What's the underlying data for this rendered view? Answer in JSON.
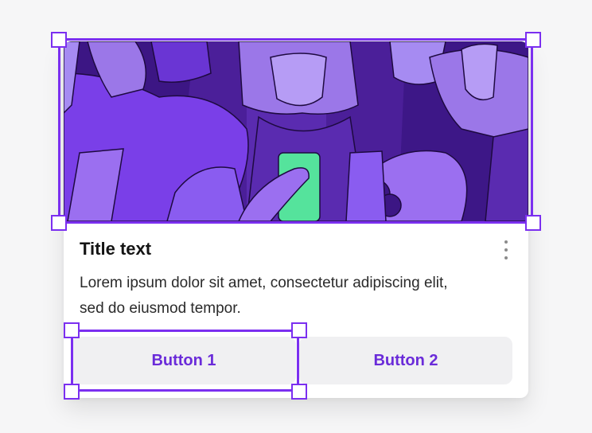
{
  "card": {
    "title": "Title text",
    "description": "Lorem ipsum dolor sit amet, consectetur adipiscing elit, sed do eiusmod tempor.",
    "buttons": [
      {
        "label": "Button 1"
      },
      {
        "label": "Button 2"
      }
    ],
    "more_menu_icon": "more-vertical-icon"
  },
  "hero_image": {
    "subject": "illustration-people-crowd-with-phone"
  },
  "colors": {
    "accent": "#7b2ff0",
    "button_text": "#6a2bd9",
    "button_bg": "#f0f0f2",
    "hero_dark": "#4b1f99",
    "hero_light": "#a68bf2",
    "phone_green": "#55e39c"
  }
}
